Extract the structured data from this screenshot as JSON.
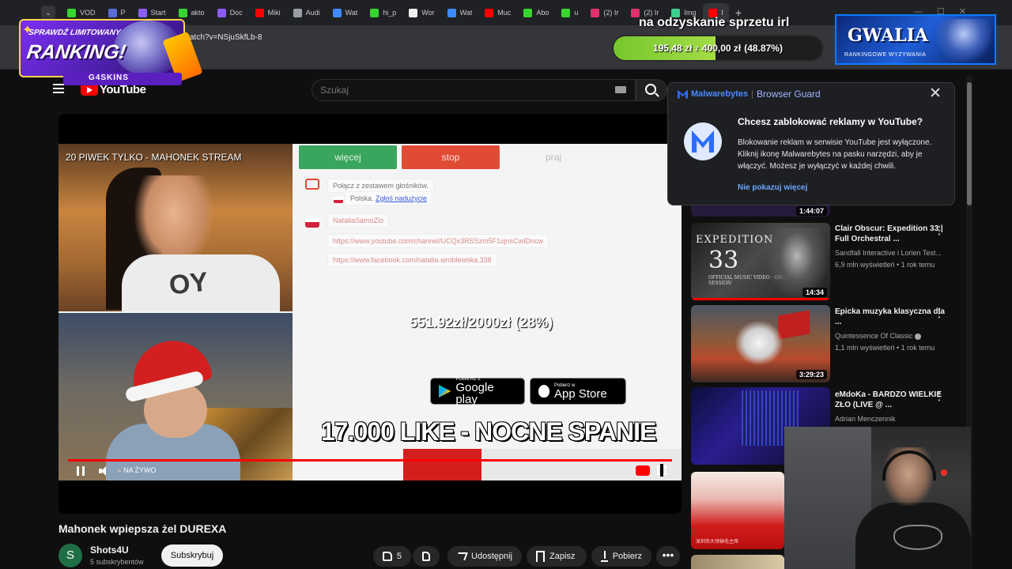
{
  "browser": {
    "tabs": [
      {
        "label": "VOD",
        "color": "#38d430"
      },
      {
        "label": "P",
        "color": "#5b6bd8"
      },
      {
        "label": "Start",
        "color": "#8b5cf6"
      },
      {
        "label": "akto",
        "color": "#38d430"
      },
      {
        "label": "Doc",
        "color": "#8b5cf6"
      },
      {
        "label": "Miki",
        "color": "#ff0000"
      },
      {
        "label": "Audi",
        "color": "#9aa0a6"
      },
      {
        "label": "Wat",
        "color": "#3d8bff"
      },
      {
        "label": "hi_p",
        "color": "#38d430"
      },
      {
        "label": "Wor",
        "color": "#eeeeee"
      },
      {
        "label": "Wat",
        "color": "#3d8bff"
      },
      {
        "label": "Muc",
        "color": "#ff0000"
      },
      {
        "label": "Abo",
        "color": "#38d430"
      },
      {
        "label": "u",
        "color": "#38d430"
      },
      {
        "label": "(2) Ir",
        "color": "#e1306c"
      },
      {
        "label": "(2) Ir",
        "color": "#e1306c"
      },
      {
        "label": "Img",
        "color": "#3ecf8e"
      },
      {
        "label": "I",
        "color": "#ff0000"
      }
    ],
    "new_tab_symbol": "+",
    "url": "/watch?v=NSjuSkfLb-8"
  },
  "overlays": {
    "ranking_small": "SPRAWDŹ LIMITOWANY",
    "ranking_big": "RANKING!",
    "ranking_brand": "G4SKINS",
    "donate_title": "na odzyskanie sprzetu irl",
    "donate_current": "195,48 zł",
    "donate_separator": "z",
    "donate_target": "400,00 zł",
    "donate_percent_text": "(48.87%)",
    "donate_progress": 48.87,
    "gwalia_title": "GWALIA",
    "gwalia_subtitle": "RANKINGOWE WYZYWANIA"
  },
  "youtube": {
    "logo_text": "YouTube",
    "search_placeholder": "Szukaj",
    "stream": {
      "cam_title": "20 PIWEK TYLKO - MAHONEK STREAM",
      "shirt_text": "OY",
      "tab_more": "więcej",
      "tab_stop": "stop",
      "tab_praj": "praj",
      "chat_connect": "Połącz z zestawem głośników.",
      "chat_country": "Polska.",
      "chat_report": "Zgłoś nadużycie",
      "chat_user": "NataliaSamoZlo",
      "chat_link_1": "https://www.youtube.com/channel/UCQx3RSSzm5F1xjnsCwIDncw",
      "chat_link_2": "https://www.facebook.com/natalia.wroblewska.338",
      "gplay_small": "POBIERZ Z",
      "gplay_big": "Google play",
      "appstore_small": "Pobierz w",
      "appstore_big": "App Store",
      "like_goal": "17.000 LIKE - NOCNE SPANIE",
      "money_goal": "551.92zł/2000zł (28%)",
      "money_progress": 28
    },
    "player": {
      "live_label": "NA ŻYWO"
    },
    "video": {
      "title": "Mahonek wpiepsza żel DUREXA",
      "channel_initial": "S",
      "channel_name": "Shots4U",
      "subscribers": "5 subskrybentów",
      "subscribe_label": "Subskrybuj",
      "likes": "5",
      "share_label": "Udostępnij",
      "save_label": "Zapisz",
      "download_label": "Pobierz",
      "more_symbol": "•••"
    },
    "sidebar": {
      "top_duration": "1:44:07",
      "items": [
        {
          "title": "Clair Obscur: Expedition 33 | Full Orchestral ...",
          "channel": "Sandfall Interactive i Lorien Test...",
          "views": "6,9 mln wyświetleń • 1 rok temu",
          "duration": "14:34",
          "thumb_title": "EXPEDITION",
          "thumb_number": "33",
          "thumb_sub": "OFFICIAL MUSIC VIDEO · ORCHESTRAL SESSION"
        },
        {
          "title": "Epicka muzyka klasyczna dla ...",
          "channel": "Quintessence Of Classic",
          "views": "1,1 mln wyświetleń • 1 rok temu",
          "duration": "3:29:23"
        },
        {
          "title": "eMdoKa - BARDZO WIELKIE ZŁO  (LIVE @ ...",
          "channel": "Adrian Menczennik"
        }
      ],
      "red_thumb_caption": "深圳伟大领袖毛主席"
    }
  },
  "malwarebytes": {
    "brand": "Malwarebytes",
    "separator": "|",
    "product": "Browser Guard",
    "question": "Chcesz zablokować reklamy w YouTube?",
    "body": "Blokowanie reklam w serwisie YouTube jest wyłączone. Kliknij ikonę Malwarebytes na pasku narzędzi, aby je włączyć. Możesz je wyłączyć w każdej chwili.",
    "dismiss_label": "Nie pokazuj więcej"
  },
  "colors": {
    "youtube_red": "#ff0000",
    "mb_blue": "#2d6cff",
    "donate_green": "#76c72d"
  }
}
